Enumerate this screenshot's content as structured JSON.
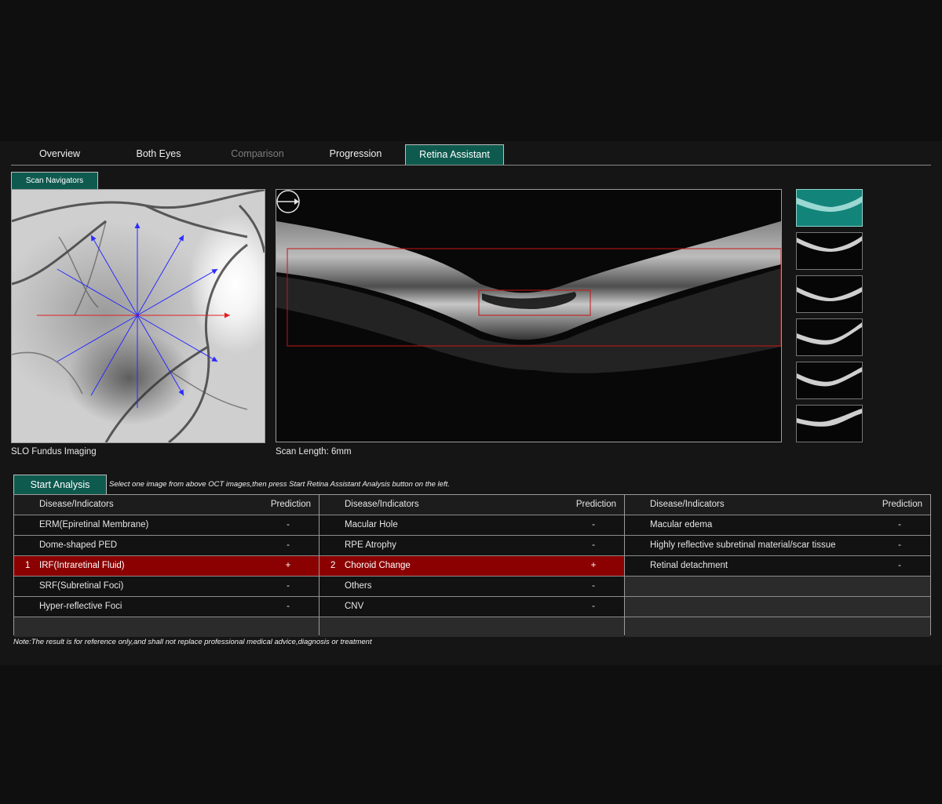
{
  "tabs": [
    {
      "label": "Overview"
    },
    {
      "label": "Both Eyes"
    },
    {
      "label": "Comparison"
    },
    {
      "label": "Progression"
    },
    {
      "label": "Retina Assistant"
    }
  ],
  "scan_navigators_label": "Scan Navigators",
  "fundus_caption": "SLO Fundus Imaging",
  "oct_caption": "Scan Length: 6mm",
  "start_analysis_label": "Start Analysis",
  "instruction": "Select one image from above OCT images,then press Start Retina Assistant Analysis button on the left.",
  "table": {
    "header_disease": "Disease/Indicators",
    "header_prediction": "Prediction",
    "columns": [
      {
        "rows": [
          {
            "index": "",
            "name": "ERM(Epiretinal Membrane)",
            "prediction": "-"
          },
          {
            "index": "",
            "name": "Dome-shaped PED",
            "prediction": "-"
          },
          {
            "index": "1",
            "name": "IRF(Intraretinal Fluid)",
            "prediction": "+"
          },
          {
            "index": "",
            "name": "SRF(Subretinal Foci)",
            "prediction": "-"
          },
          {
            "index": "",
            "name": "Hyper-reflective Foci",
            "prediction": "-"
          }
        ]
      },
      {
        "rows": [
          {
            "index": "",
            "name": "Macular Hole",
            "prediction": "-"
          },
          {
            "index": "",
            "name": "RPE Atrophy",
            "prediction": "-"
          },
          {
            "index": "2",
            "name": "Choroid Change",
            "prediction": "+"
          },
          {
            "index": "",
            "name": "Others",
            "prediction": "-"
          },
          {
            "index": "",
            "name": "CNV",
            "prediction": "-"
          }
        ]
      },
      {
        "rows": [
          {
            "index": "",
            "name": "Macular edema",
            "prediction": "-"
          },
          {
            "index": "",
            "name": "Highly reflective subretinal material/scar tissue",
            "prediction": "-"
          },
          {
            "index": "",
            "name": "Retinal detachment",
            "prediction": "-"
          }
        ]
      }
    ]
  },
  "note": "Note:The result is for reference only,and shall not replace professional medical advice,diagnosis or treatment",
  "colors": {
    "accent": "#0f5a4f",
    "positive_row": "#8b0000",
    "scan_line": "#2a2aff",
    "selected_scan_line": "#e02020"
  }
}
